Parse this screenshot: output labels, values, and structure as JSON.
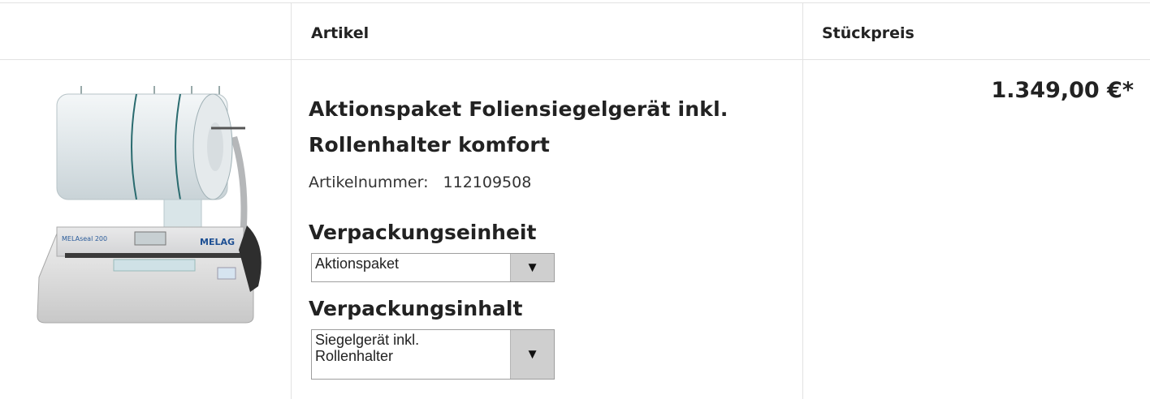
{
  "table": {
    "headers": {
      "article": "Artikel",
      "unit_price": "Stückpreis"
    }
  },
  "product": {
    "image_alt": "MELAseal 200 Foliensiegelgerät mit Rollenhalter",
    "image_text": {
      "model": "MELAseal 200",
      "brand": "MELAG"
    },
    "title": "Aktionspaket Foliensiegelgerät inkl. Rollenhalter komfort",
    "article_number_label": "Artikelnummer:",
    "article_number": "112109508",
    "options": [
      {
        "label": "Verpackungseinheit",
        "selected": "Aktionspaket"
      },
      {
        "label": "Verpackungsinhalt",
        "selected": "Siegelgerät inkl. Rollenhalter"
      }
    ],
    "price": "1.349,00 €*"
  },
  "icons": {
    "dropdown": "triangle-down-icon"
  }
}
